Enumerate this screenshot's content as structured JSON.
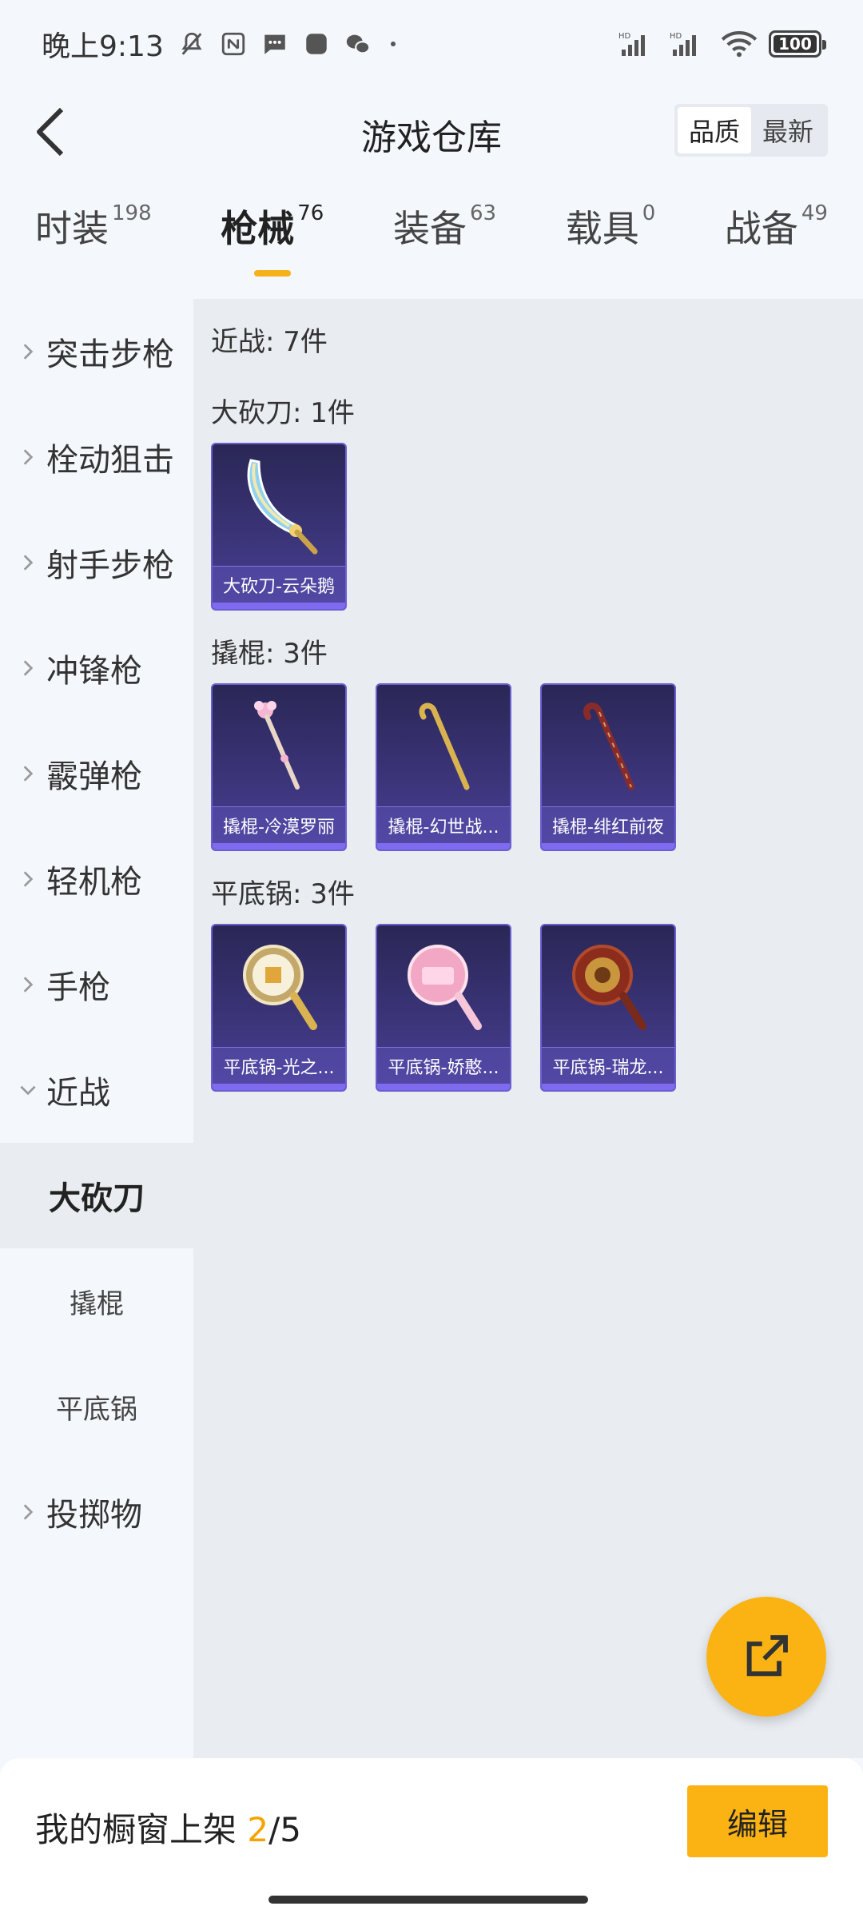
{
  "status": {
    "time": "晚上9:13",
    "battery": "100"
  },
  "header": {
    "title": "游戏仓库",
    "sort_options": [
      "品质",
      "最新"
    ],
    "active_sort": "品质"
  },
  "tabs": [
    {
      "label": "时装",
      "count": "198"
    },
    {
      "label": "枪械",
      "count": "76",
      "active": true
    },
    {
      "label": "装备",
      "count": "63"
    },
    {
      "label": "载具",
      "count": "0"
    },
    {
      "label": "战备",
      "count": "49"
    }
  ],
  "sidebar": {
    "items": [
      {
        "label": "突击步枪"
      },
      {
        "label": "栓动狙击"
      },
      {
        "label": "射手步枪"
      },
      {
        "label": "冲锋枪"
      },
      {
        "label": "霰弹枪"
      },
      {
        "label": "轻机枪"
      },
      {
        "label": "手枪"
      },
      {
        "label": "近战",
        "expanded": true
      }
    ],
    "subitems": [
      {
        "label": "大砍刀",
        "active": true
      },
      {
        "label": "撬棍"
      },
      {
        "label": "平底锅"
      }
    ],
    "last_item": {
      "label": "投掷物"
    }
  },
  "main": {
    "section_title": "近战: 7件",
    "groups": [
      {
        "title": "大砍刀: 1件",
        "items": [
          "大砍刀-云朵鹅"
        ]
      },
      {
        "title": "撬棍: 3件",
        "items": [
          "撬棍-冷漠罗丽",
          "撬棍-幻世战...",
          "撬棍-绯红前夜"
        ]
      },
      {
        "title": "平底锅: 3件",
        "items": [
          "平底锅-光之...",
          "平底锅-娇憨...",
          "平底锅-瑞龙..."
        ]
      }
    ]
  },
  "bottom": {
    "shelf_label": "我的橱窗上架 ",
    "shelf_current": "2",
    "shelf_total": "/5",
    "edit_label": "编辑"
  },
  "colors": {
    "accent": "#fbb313",
    "card_bg": "#3a3478",
    "card_border": "#6a5fd0"
  }
}
